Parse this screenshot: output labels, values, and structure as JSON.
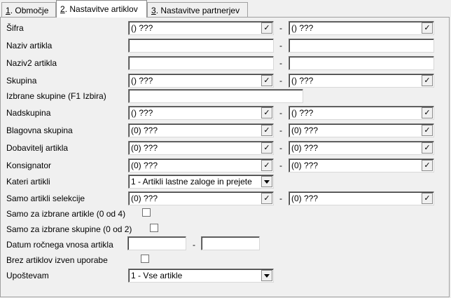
{
  "tabs": [
    {
      "num": "1",
      "label": ". Območje"
    },
    {
      "num": "2",
      "label": ". Nastavitve artiklov"
    },
    {
      "num": "3",
      "label": ". Nastavitve partnerjev"
    }
  ],
  "fields": {
    "sifra": {
      "label": "Šifra",
      "from": "() ???",
      "to": "() ???"
    },
    "naziv": {
      "label": "Naziv artikla",
      "from": "",
      "to": ""
    },
    "naziv2": {
      "label": "Naziv2 artikla",
      "from": "",
      "to": ""
    },
    "skupina": {
      "label": "Skupina",
      "from": "() ???",
      "to": "() ???"
    },
    "izbrane_skupine": {
      "label": "Izbrane skupine (F1 Izbira)",
      "value": ""
    },
    "nadskupina": {
      "label": "Nadskupina",
      "from": "() ???",
      "to": "() ???"
    },
    "blagovna": {
      "label": "Blagovna skupina",
      "from": "(0) ???",
      "to": "(0) ???"
    },
    "dobavitelj": {
      "label": "Dobavitelj artikla",
      "from": "(0) ???",
      "to": "(0) ???"
    },
    "konsignator": {
      "label": "Konsignator",
      "from": "(0) ???",
      "to": "(0) ???"
    },
    "kateri": {
      "label": "Kateri artikli",
      "value": "1 - Artikli lastne zaloge in prejete"
    },
    "selekcije": {
      "label": "Samo artikli selekcije",
      "from": "(0) ???",
      "to": "(0) ???"
    },
    "izbrane_artikle": {
      "label": "Samo za izbrane artikle (0 od 4)",
      "checked": false
    },
    "izbrane_skupine_chk": {
      "label": "Samo za izbrane skupine (0 od 2)",
      "checked": false
    },
    "datum": {
      "label": "Datum ročnega vnosa artikla",
      "from": "",
      "to": ""
    },
    "brez": {
      "label": "Brez artiklov izven uporabe",
      "checked": false
    },
    "upostevam": {
      "label": "Upoštevam",
      "value": "1 - Vse artikle"
    }
  },
  "dash": "-",
  "lookup_glyph": "✓"
}
